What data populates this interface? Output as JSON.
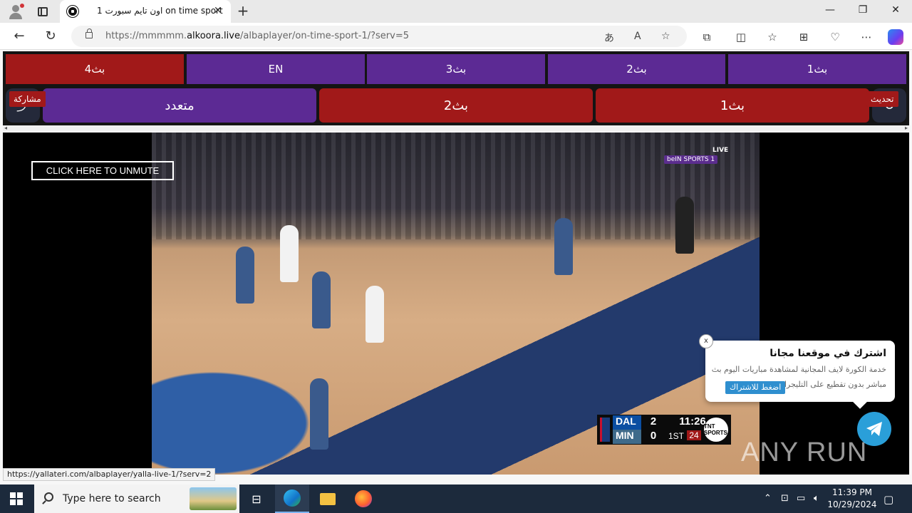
{
  "browser": {
    "tab_title": "اون تايم سبورت 1 on time sport",
    "url_prefix": "https://mmmmm.",
    "url_domain": "alkoora.live",
    "url_path": "/albaplayer/on-time-sport-1/?serv=5",
    "status_url": "https://yallateri.com/albaplayer/yalla-live-1/?serv=2"
  },
  "servers": {
    "row1": [
      "بث4",
      "EN",
      "بث3",
      "بث2",
      "بث1"
    ],
    "row2": [
      "متعدد",
      "بث2",
      "بث1"
    ],
    "share_label": "مشاركة",
    "refresh_label": "تحديث"
  },
  "player": {
    "unmute_label": "CLICK HERE TO UNMUTE",
    "live_label": "LIVE",
    "channel_label": "beIN SPORTS 1",
    "score": {
      "team1": "DAL",
      "score1": "2",
      "team2": "MIN",
      "score2": "0",
      "clock": "11:26",
      "period": "1ST",
      "shot_clock": "24",
      "network": "TNT SPORTS"
    }
  },
  "popup": {
    "title": "اشترك في موقعنا مجانا",
    "text": "خدمة الكورة لايف المجانية لمشاهدة مباريات اليوم بث مباشر بدون تقطيع على التليجرام",
    "button": "اضغط للاشتراك",
    "close": "x"
  },
  "watermark": "ANY RUN",
  "taskbar": {
    "search_placeholder": "Type here to search",
    "time": "11:39 PM",
    "date": "10/29/2024"
  }
}
